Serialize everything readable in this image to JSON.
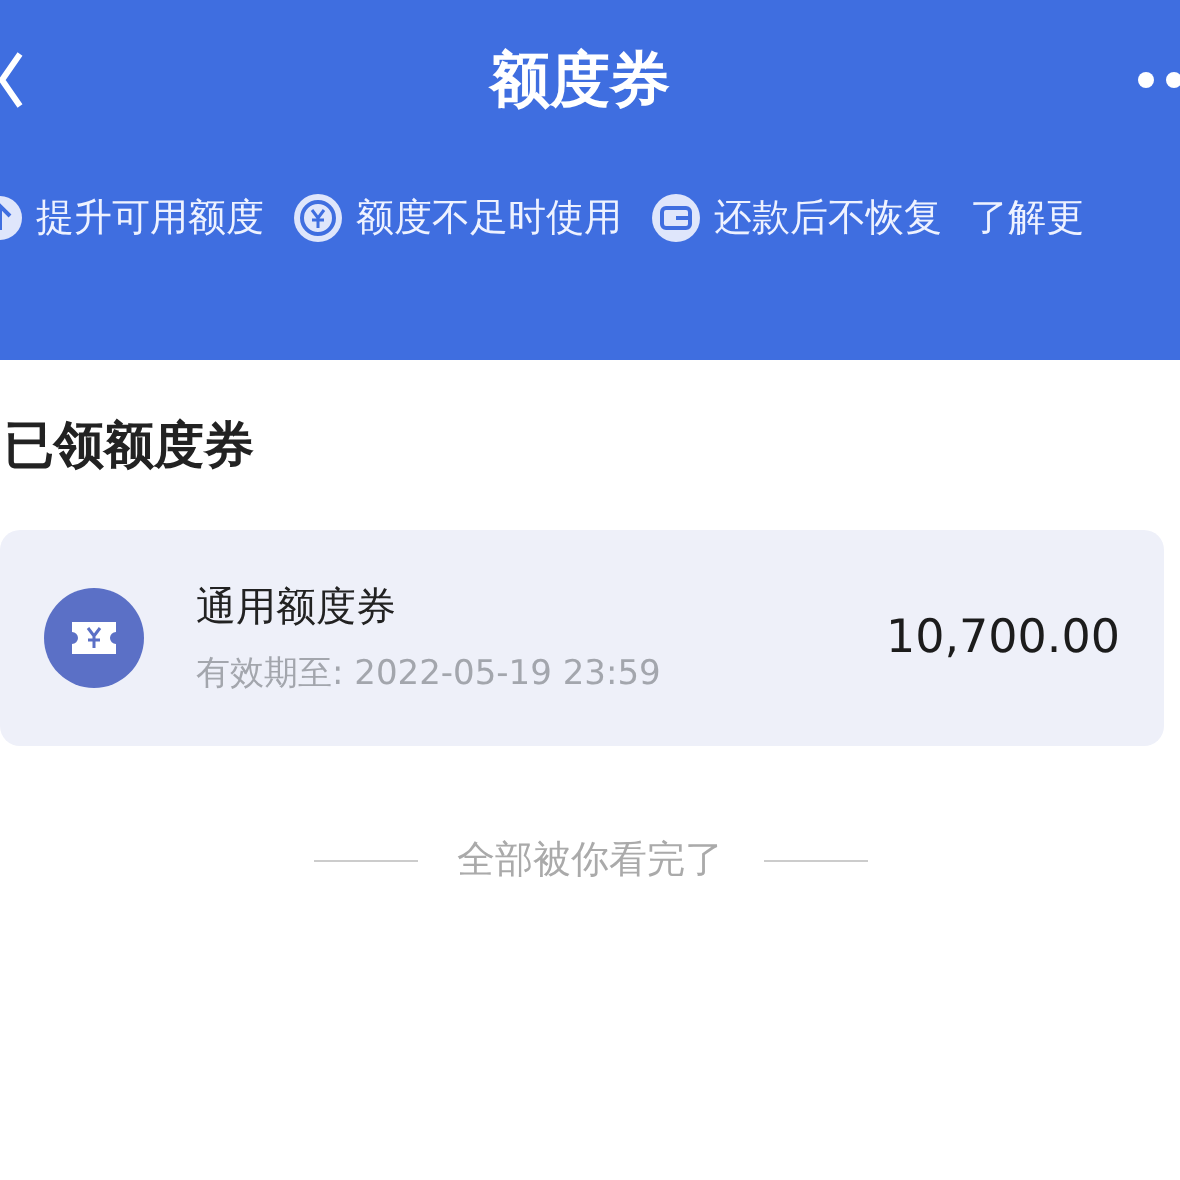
{
  "header": {
    "title": "额度券"
  },
  "features": [
    {
      "kind": "arrow",
      "text": "提升可用额度"
    },
    {
      "kind": "coin",
      "text": "额度不足时使用"
    },
    {
      "kind": "card",
      "text": "还款后不恢复"
    },
    {
      "kind": "link",
      "text": "了解更"
    }
  ],
  "section_title": "已领额度券",
  "coupons": [
    {
      "name": "通用额度券",
      "validity": "有效期至: 2022-05-19 23:59",
      "amount": "10,700.00"
    }
  ],
  "end_note": "全部被你看完了"
}
